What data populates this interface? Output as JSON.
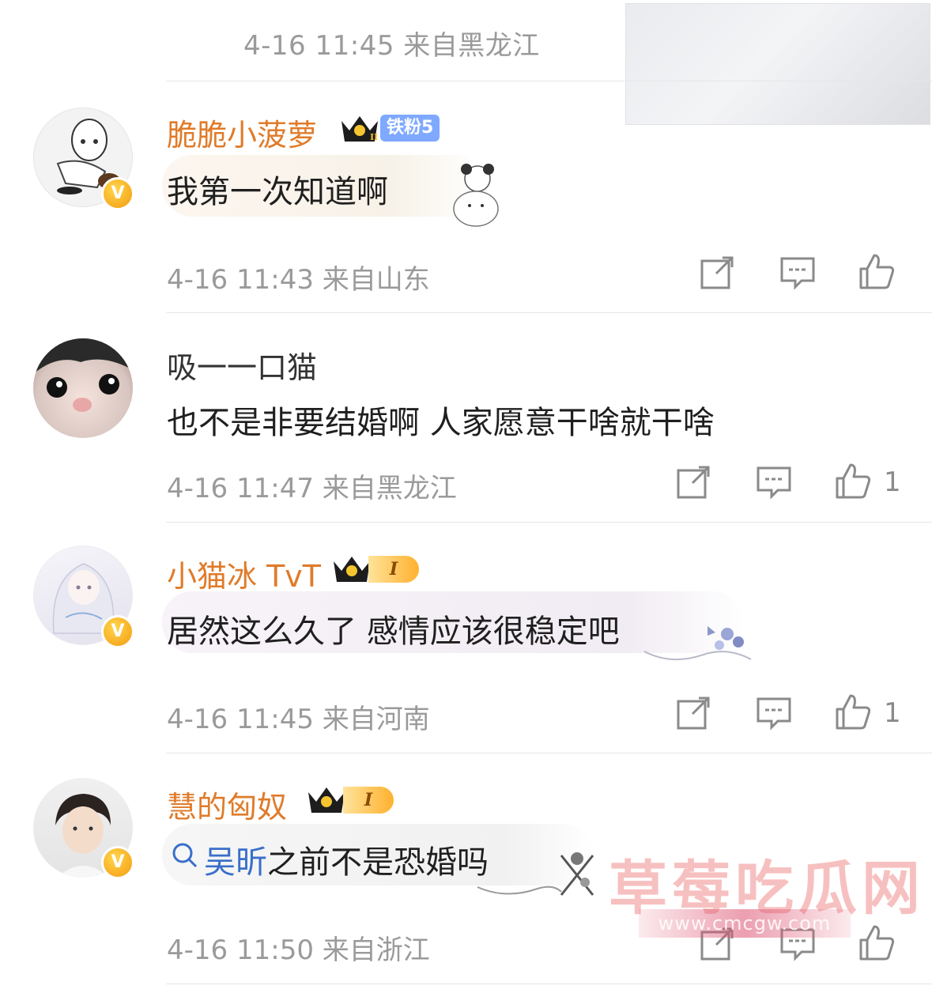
{
  "top": {
    "meta": "4-16 11:45  来自黑龙江"
  },
  "comments": [
    {
      "username": "脆脆小菠萝",
      "fan_badge": "铁粉5",
      "level": "II",
      "text": "我第一次知道啊",
      "meta": "4-16 11:43  来自山东",
      "likes": ""
    },
    {
      "username": "吸一一口猫",
      "text": "也不是非要结婚啊 人家愿意干啥就干啥",
      "meta": "4-16 11:47  来自黑龙江",
      "likes": "1"
    },
    {
      "username": "小猫冰 TvT",
      "level": "I",
      "text": "居然这么久了 感情应该很稳定吧",
      "meta": "4-16 11:45  来自河南",
      "likes": "1"
    },
    {
      "username": "慧的匈奴",
      "level": "I",
      "search_term": "吴昕",
      "text": "之前不是恐婚吗",
      "meta": "4-16 11:50  来自浙江",
      "likes": ""
    }
  ],
  "watermark": {
    "title": "草莓吃瓜网",
    "url": "www.cmcgw.com"
  },
  "colors": {
    "username": "#e07b2a",
    "link": "#3a6fc9",
    "meta": "#9a9a9a",
    "vip_badge": "#f49a12",
    "fan_badge": "#7fa9ff"
  },
  "icons": [
    "repost-icon",
    "comment-icon",
    "like-icon",
    "crown-icon",
    "verified-v-icon",
    "search-icon"
  ]
}
